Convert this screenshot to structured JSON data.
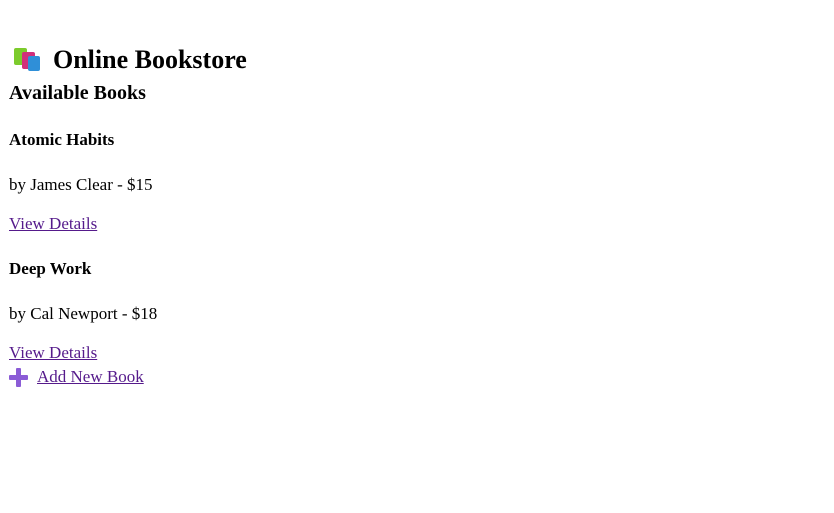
{
  "header": {
    "title": "Online Bookstore",
    "icon": "books-icon"
  },
  "section": {
    "title": "Available Books"
  },
  "books": [
    {
      "title": "Atomic Habits",
      "meta": "by James Clear - $15",
      "link_label": "View Details"
    },
    {
      "title": "Deep Work",
      "meta": "by Cal Newport - $18",
      "link_label": "View Details"
    }
  ],
  "actions": {
    "add_label": "Add New Book",
    "add_icon": "plus-icon"
  },
  "colors": {
    "link": "#551a8b",
    "plus_icon": "#8b5cd6"
  }
}
